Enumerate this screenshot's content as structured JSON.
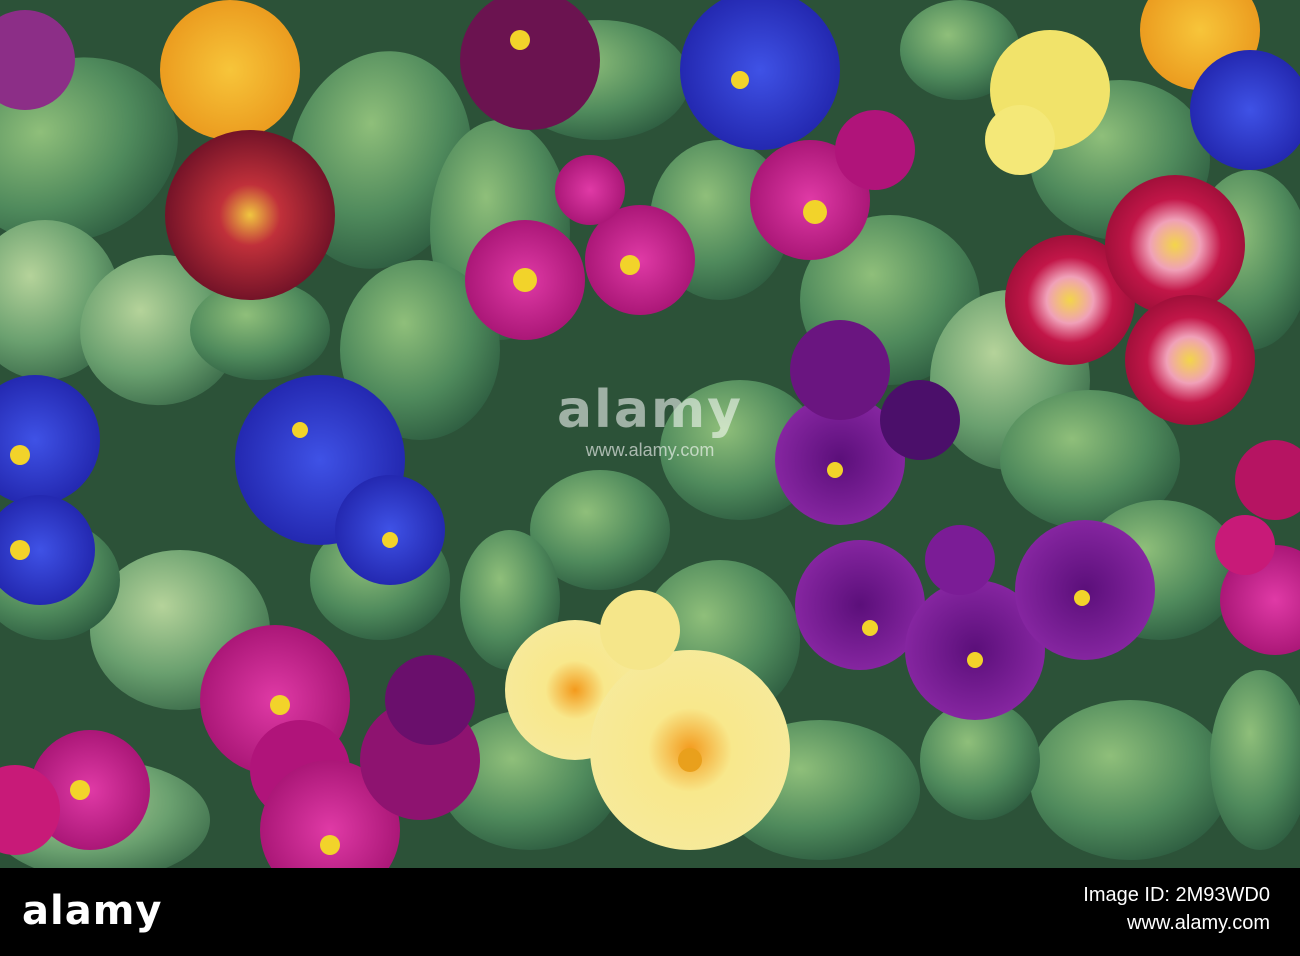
{
  "watermark": {
    "logo": "alamy",
    "url": "www.alamy.com"
  },
  "footer": {
    "logo": "alamy",
    "image_id": "Image ID: 2M93WD0",
    "url": "www.alamy.com"
  },
  "colors": {
    "background_leaf": "#3e7a55",
    "footer_bg": "#000000",
    "flower_blue": "#2b35c8",
    "flower_purple": "#6a1b8a",
    "flower_magenta": "#c21a86",
    "flower_yellow": "#f4e37a",
    "flower_orange": "#f3a825",
    "flower_red": "#b0123e",
    "flower_center": "#f2d32a"
  }
}
